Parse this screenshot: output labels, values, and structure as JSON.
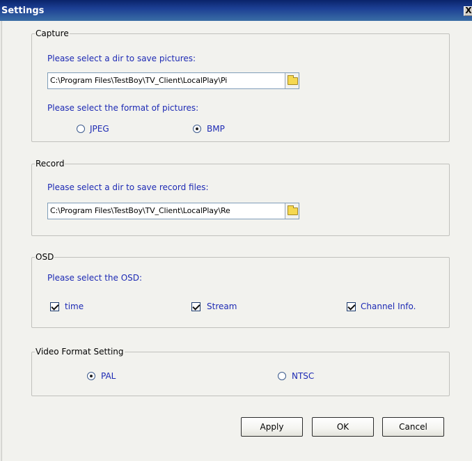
{
  "window": {
    "title": "Settings",
    "close_glyph": "X"
  },
  "capture": {
    "legend": "Capture",
    "dir_prompt": "Please select a dir to save pictures:",
    "dir_value": "C:\\Program Files\\TestBoy\\TV_Client\\LocalPlay\\Pi",
    "format_prompt": "Please select the format of pictures:",
    "formats": [
      {
        "label": "JPEG",
        "selected": false
      },
      {
        "label": "BMP",
        "selected": true
      }
    ]
  },
  "record": {
    "legend": "Record",
    "dir_prompt": "Please select a dir to save record files:",
    "dir_value": "C:\\Program Files\\TestBoy\\TV_Client\\LocalPlay\\Re"
  },
  "osd": {
    "legend": "OSD",
    "prompt": "Please select the OSD:",
    "options": [
      {
        "label": "time",
        "checked": true
      },
      {
        "label": "Stream",
        "checked": true
      },
      {
        "label": "Channel Info.",
        "checked": true
      }
    ]
  },
  "video_format": {
    "legend": "Video Format Setting",
    "options": [
      {
        "label": "PAL",
        "selected": true
      },
      {
        "label": "NTSC",
        "selected": false
      }
    ]
  },
  "buttons": {
    "apply": "Apply",
    "ok": "OK",
    "cancel": "Cancel"
  },
  "icons": {
    "browse": "folder-icon",
    "close": "close-icon"
  },
  "colors": {
    "title_bar": "#0a246a",
    "prompt_text": "#1d2ab4",
    "dialog_bg": "#f2f2ee"
  }
}
